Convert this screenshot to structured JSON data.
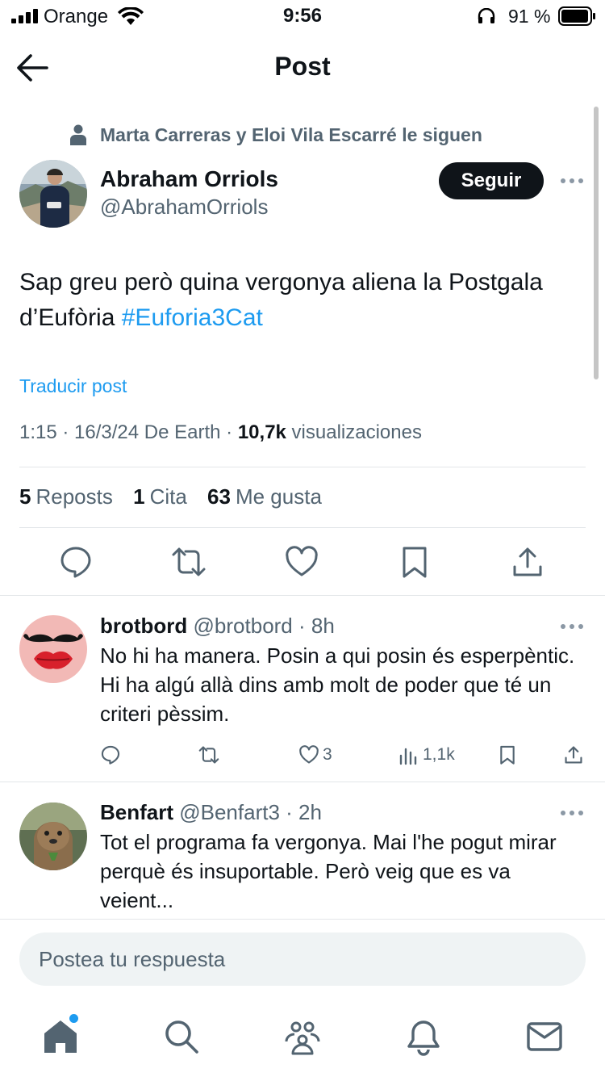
{
  "status_bar": {
    "carrier": "Orange",
    "time": "9:56",
    "battery_percent": "91 %"
  },
  "header": {
    "title": "Post"
  },
  "post": {
    "social_context": "Marta Carreras y Eloi Vila Escarré le siguen",
    "author": {
      "name": "Abraham Orriols",
      "handle": "@AbrahamOrriols"
    },
    "follow_label": "Seguir",
    "text": "Sap greu però quina vergonya aliena la Postgala d’Eufòria",
    "hashtag": "#Euforia3Cat",
    "translate_label": "Traducir post",
    "meta": {
      "time_date_source": "1:15 · 16/3/24 De Earth · ",
      "views_count": "10,7k",
      "views_label": " visualizaciones"
    },
    "stats": {
      "reposts_count": "5",
      "reposts_label": "Reposts",
      "quotes_count": "1",
      "quotes_label": "Cita",
      "likes_count": "63",
      "likes_label": "Me gusta"
    }
  },
  "replies": [
    {
      "name": "brotbord",
      "handle_time": " @brotbord · 8h",
      "text": "No hi ha manera. Posin a qui posin és esperpèntic. Hi ha algú allà dins amb molt de poder que té un criteri pèssim.",
      "likes": "3",
      "views": "1,1k"
    },
    {
      "name": "Benfart",
      "handle_time": " @Benfart3 · 2h",
      "text": "Tot el programa fa vergonya. Mai l'he pogut mirar perquè és insuportable. Però veig que es va veient..."
    }
  ],
  "composer": {
    "placeholder": "Postea tu respuesta"
  },
  "colors": {
    "accent": "#1d9bf0",
    "text_primary": "#0f1419",
    "text_secondary": "#536471"
  },
  "icons": [
    "back-arrow-icon",
    "person-icon",
    "more-icon",
    "reply-icon",
    "repost-icon",
    "like-icon",
    "bookmark-icon",
    "share-icon",
    "views-icon",
    "home-icon",
    "search-icon",
    "communities-icon",
    "notifications-icon",
    "messages-icon"
  ]
}
